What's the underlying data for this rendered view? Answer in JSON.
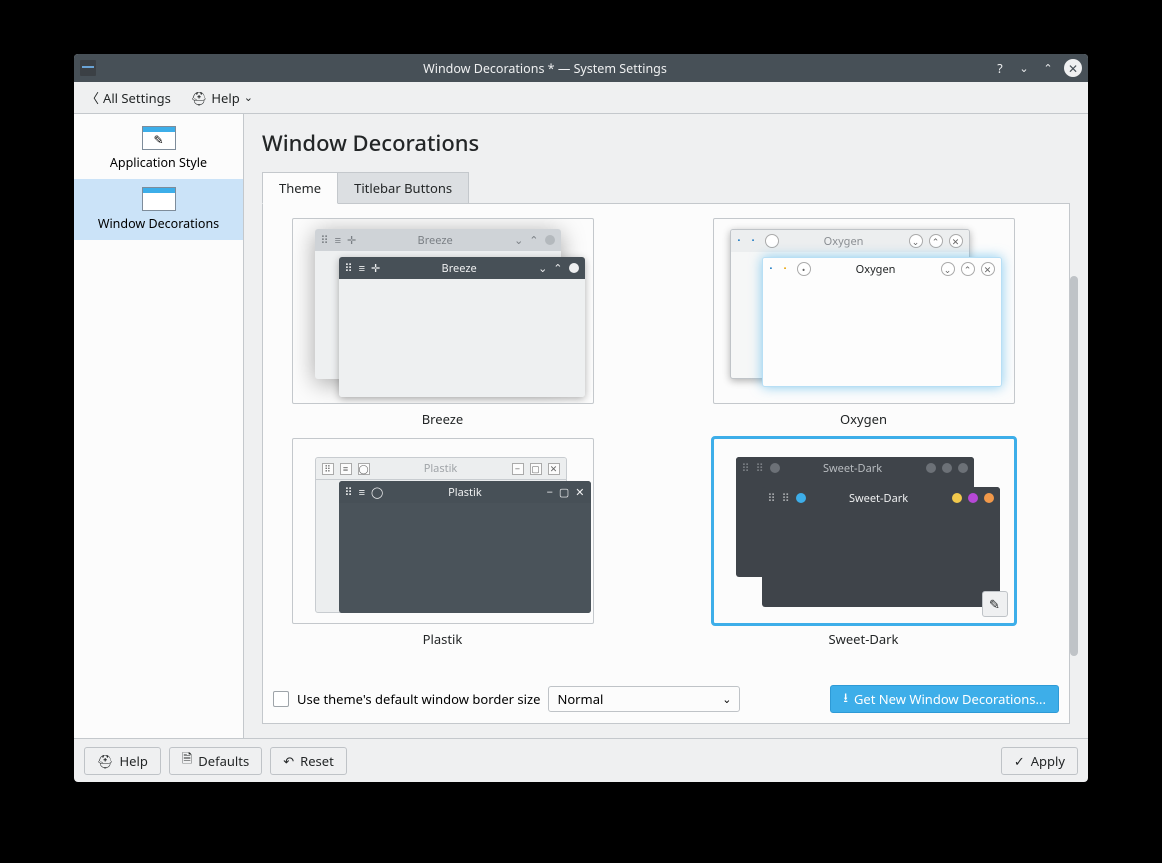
{
  "titlebar": {
    "title": "Window Decorations * — System Settings"
  },
  "toolbar": {
    "all_settings": "All Settings",
    "help": "Help"
  },
  "sidebar": {
    "items": [
      {
        "label": "Application Style"
      },
      {
        "label": "Window Decorations"
      }
    ]
  },
  "page": {
    "heading": "Window Decorations",
    "tabs": [
      {
        "label": "Theme"
      },
      {
        "label": "Titlebar Buttons"
      }
    ]
  },
  "themes": [
    {
      "name": "Breeze"
    },
    {
      "name": "Oxygen"
    },
    {
      "name": "Plastik"
    },
    {
      "name": "Sweet-Dark"
    }
  ],
  "preview": {
    "breeze": "Breeze",
    "oxygen": "Oxygen",
    "plastik": "Plastik",
    "sweetdark": "Sweet-Dark"
  },
  "panel_footer": {
    "checkbox_label": "Use theme's default window border size",
    "border_size": "Normal",
    "get_new": "Get New Window Decorations..."
  },
  "footer": {
    "help": "Help",
    "defaults": "Defaults",
    "reset": "Reset",
    "apply": "Apply"
  }
}
